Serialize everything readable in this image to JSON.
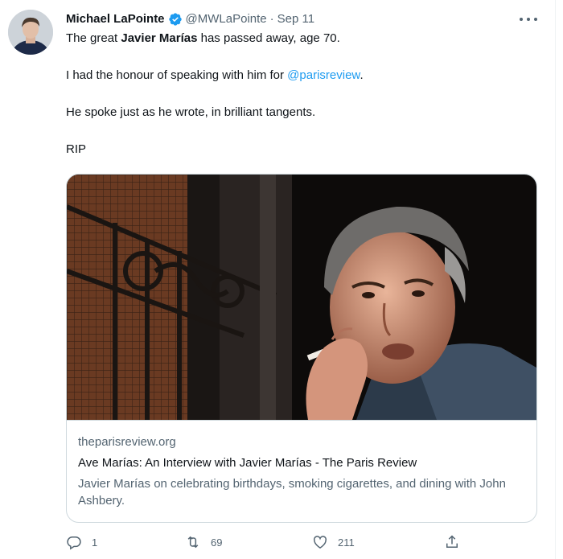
{
  "tweet": {
    "display_name": "Michael LaPointe",
    "handle": "@MWLaPointe",
    "separator": "·",
    "date": "Sep 11",
    "line1_pre": "The great ",
    "line1_bold": "Javier Marías",
    "line1_post": " has passed away, age 70.",
    "line2_pre": "I had the honour of speaking with him for ",
    "line2_mention": "@parisreview",
    "line2_post": ".",
    "line3": "He spoke just as he wrote, in brilliant tangents.",
    "line4": "RIP"
  },
  "card": {
    "domain": "theparisreview.org",
    "title": "Ave Marías: An Interview with Javier Marías - The Paris Review",
    "description": "Javier Marías on celebrating birthdays, smoking cigarettes, and dining with John Ashbery."
  },
  "actions": {
    "reply_count": "1",
    "retweet_count": "69",
    "like_count": "211"
  },
  "colors": {
    "accent": "#1d9bf0",
    "muted": "#536471",
    "text": "#0f1419"
  },
  "icons": [
    "verified-badge-icon",
    "more-icon",
    "reply-icon",
    "retweet-icon",
    "like-icon",
    "share-icon"
  ]
}
